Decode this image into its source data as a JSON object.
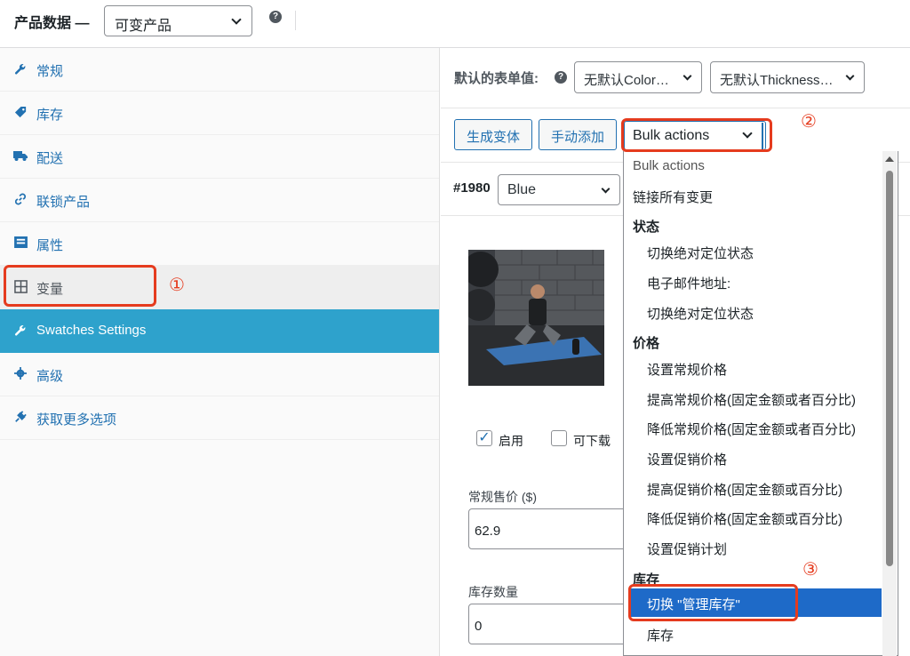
{
  "header": {
    "title": "产品数据 —",
    "product_type": "可变产品",
    "help": "?"
  },
  "sidebar": {
    "items": [
      {
        "label": "常规",
        "icon": "wrench-icon"
      },
      {
        "label": "库存",
        "icon": "tag-icon"
      },
      {
        "label": "配送",
        "icon": "truck-icon"
      },
      {
        "label": "联锁产品",
        "icon": "link-icon"
      },
      {
        "label": "属性",
        "icon": "list-icon"
      },
      {
        "label": "变量",
        "icon": "grid-icon"
      },
      {
        "label": "Swatches Settings",
        "icon": "wrench-icon"
      },
      {
        "label": "高级",
        "icon": "gear-icon"
      },
      {
        "label": "获取更多选项",
        "icon": "plugin-icon"
      }
    ]
  },
  "defaults": {
    "label": "默认的表单值:",
    "color": "无默认Color…",
    "thickness": "无默认Thickness…"
  },
  "toolbar": {
    "generate": "生成变体",
    "manual_add": "手动添加",
    "bulk_actions": "Bulk actions"
  },
  "variation": {
    "id": "#1980",
    "color": "Blue",
    "enabled_label": "启用",
    "enabled": true,
    "downloadable_label": "可下载",
    "downloadable": false,
    "price_label": "常规售价 ($)",
    "price": "62.9",
    "stock_label": "库存数量",
    "stock": "0"
  },
  "dropdown": {
    "placeholder": "Bulk actions",
    "link_all": "链接所有变更",
    "group_status": "状态",
    "status_items": [
      "切换绝对定位状态",
      "电子邮件地址:",
      "切换绝对定位状态"
    ],
    "group_price": "价格",
    "price_items": [
      "设置常规价格",
      "提高常规价格(固定金额或者百分比)",
      "降低常规价格(固定金额或者百分比)",
      "设置促销价格",
      "提高促销价格(固定金额或百分比)",
      "降低促销价格(固定金额或百分比)",
      "设置促销计划"
    ],
    "group_stock": "库存",
    "stock_items": [
      "切换 \"管理库存\"",
      "库存"
    ]
  },
  "annotations": {
    "n1": "①",
    "n2": "②",
    "n3": "③",
    "color": "#e53b1e"
  },
  "colors": {
    "accent": "#2271b1",
    "highlight_row": "#2ea2cc",
    "active_option": "#1e6ac8"
  }
}
